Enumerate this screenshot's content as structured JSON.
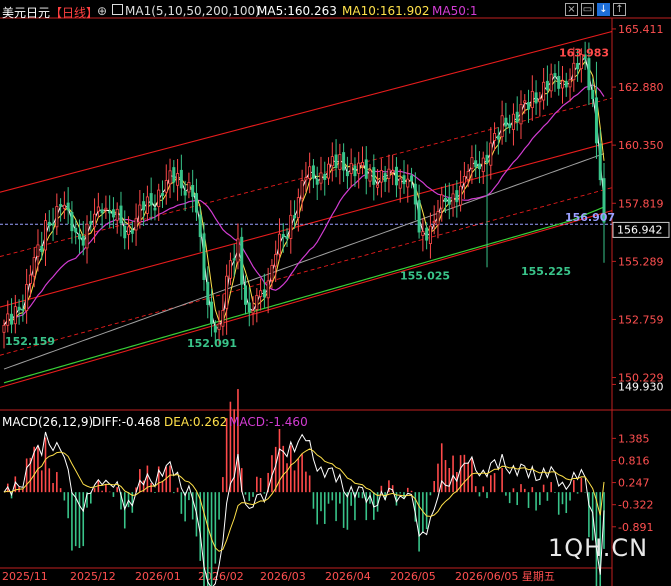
{
  "header": {
    "symbol": "美元日元",
    "period": "【日线】",
    "ma_title": "MA1(5,10,50,200,100)",
    "ma5": "MA5:160.263",
    "ma10": "MA10:161.902",
    "ma50": "MA50:1",
    "icons": [
      "close-icon",
      "restore-icon",
      "download-icon",
      "up-icon"
    ]
  },
  "macd_header": {
    "title": "MACD(26,12,9)",
    "diff": "DIFF:-0.468",
    "dea": "DEA:0.262",
    "macd": "MACD:-1.460"
  },
  "colors": {
    "up": "#ff4a4a",
    "down": "#39c48a",
    "ma5": "#ffffff",
    "ma10": "#ffe14a",
    "ma50": "#d23cd2",
    "ma100": "#a0a0a0",
    "ma200": "#37d037",
    "channel": "#ff2020",
    "price_label": "#ffffff"
  },
  "watermark": "1QH.CN",
  "chart_data": [
    {
      "type": "candlestick",
      "ylim": [
        149.6,
        165.8
      ],
      "y_ticks": [
        "165.411",
        "162.880",
        "160.350",
        "157.819",
        "155.289",
        "152.759",
        "150.229",
        "149.930"
      ],
      "current_price": "156.942",
      "annotations": [
        {
          "text": "163.983",
          "value": 163.983,
          "kind": "high"
        },
        {
          "text": "152.159",
          "value": 152.159,
          "kind": "low"
        },
        {
          "text": "152.091",
          "value": 152.091,
          "kind": "low"
        },
        {
          "text": "155.025",
          "value": 155.025,
          "kind": "low"
        },
        {
          "text": "155.225",
          "value": 155.225,
          "kind": "low"
        },
        {
          "text": "156.907",
          "value": 156.907,
          "kind": "cursor"
        }
      ],
      "x_labels": [
        "2025/11",
        "2025/12",
        "2026/01",
        "2026/02",
        "2026/03",
        "2026/04",
        "2026/05",
        "2026/06/05 星期五"
      ]
    },
    {
      "type": "macd",
      "ylim": [
        -1.9,
        1.6
      ],
      "y_ticks": [
        "1.385",
        "0.816",
        "0.247",
        "-0.322",
        "-0.891"
      ]
    }
  ]
}
